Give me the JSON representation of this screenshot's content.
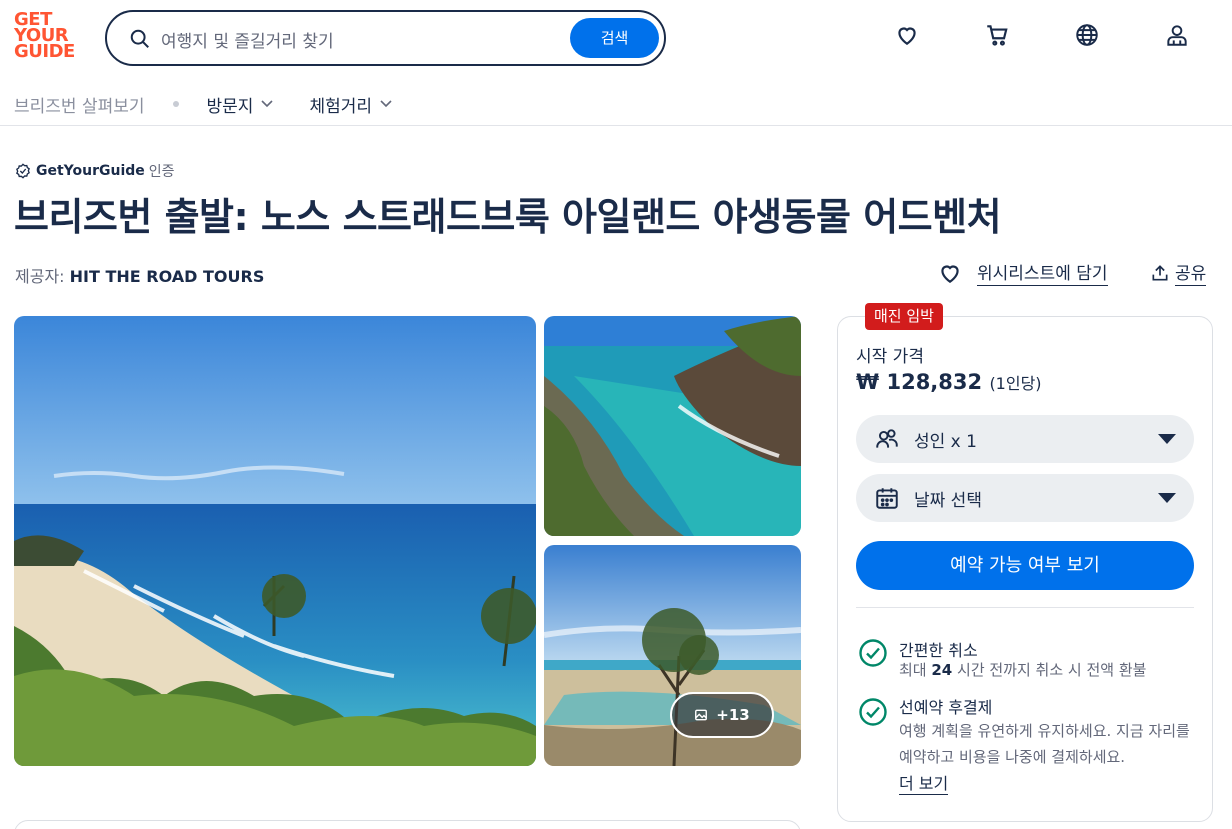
{
  "brand": {
    "logo_lines": [
      "GET",
      "YOUR",
      "GUIDE"
    ],
    "accent": "#ff5533",
    "primary": "#0071eb",
    "text": "#1a2b49",
    "sale_red": "#d21c1c"
  },
  "header": {
    "search_placeholder": "여행지 및 즐길거리 찾기",
    "search_button": "검색",
    "icons": [
      "heart-icon",
      "cart-icon",
      "globe-icon",
      "profile-icon"
    ]
  },
  "subnav": {
    "crumb": "브리즈번 살펴보기",
    "menus": [
      "방문지",
      "체험거리"
    ]
  },
  "activity": {
    "verified_brand": "GetYourGuide",
    "verified_label": "인증",
    "title": "브리즈번 출발: 노스 스트래드브룩 아일랜드 야생동물 어드벤처",
    "provider_label": "제공자: ",
    "provider_name": "HIT THE ROAD TOURS",
    "wishlist": "위시리스트에 담기",
    "share": "공유"
  },
  "gallery": {
    "more_photos": "+13"
  },
  "booking": {
    "badge": "매진 임박",
    "from_label": "시작 가격",
    "price": "₩ 128,832",
    "per": "(1인당)",
    "participants": "성인 x 1",
    "date": "날짜 선택",
    "cta": "예약 가능 여부 보기",
    "features": [
      {
        "title": "간편한 취소",
        "desc_pre": "최대 ",
        "desc_bold": "24",
        "desc_post": " 시간 전까지 취소 시 전액 환불"
      },
      {
        "title": "선예약 후결제",
        "desc": "여행 계획을 유연하게 유지하세요. 지금 자리를 예약하고 비용을 나중에 결제하세요."
      }
    ],
    "more_link": "더 보기"
  }
}
